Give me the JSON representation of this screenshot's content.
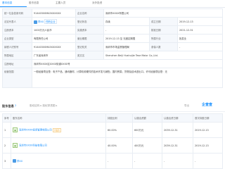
{
  "tabs": [
    "基本信息",
    "股东信息",
    "主要人员",
    "对外投资"
  ],
  "info": {
    "r1": {
      "k1": "统一社会信用代码",
      "v1": "91440300MA5XXXXXX",
      "k2": "企业名称",
      "v2": "深圳市XXXX有限公司"
    },
    "r2": {
      "k1": "法定代表人",
      "v1_name": "李XX",
      "v1_chip": "任职企业",
      "k2": "登记状态",
      "v2": "存续",
      "k3": "成立日期",
      "v3": "2019-12-13"
    },
    "r3": {
      "k1": "注册资本",
      "v1": "1000万元人民币",
      "k2": "实缴资本",
      "v2": "-",
      "k3": "核准日期",
      "v3": "2021-12-31"
    },
    "r4": {
      "k1": "企业类型",
      "v1": "有限责任公司",
      "k2": "营业期限",
      "v2": "2019-12-13 至 无固定期限",
      "k3": "所属行业",
      "v3": "批发业"
    },
    "r5": {
      "k1": "纳税人识别号",
      "v1": "91440300MA5XXXXXX",
      "k2": "登记机关",
      "v2": "深圳市市场监督管理局",
      "k3": "参保人数",
      "v3": "-"
    },
    "r6": {
      "k1": "所属地区",
      "v1": "广东省深圳市",
      "k2": "英文名",
      "v2": "Shenzhen Beiji Hushuijie Tese Maior Co.,Ltd."
    },
    "r7": {
      "k1": "注册地址",
      "v1": "深圳市XXXX区XXXX街道XXXX号"
    },
    "r8": {
      "k1": "经营范围",
      "v1": "一般经营项目是：电子产品、通讯器材、计算机软硬件的技术开发与销售；国内贸易；货物及技术进出口。许可经营项目是：无"
    }
  },
  "section": {
    "title": "股东信息",
    "count": "2",
    "tools": "股权结构 ▸  股权穿透图 ▸",
    "export": "导出",
    "logo": "企查查"
  },
  "shareholders": {
    "headers": [
      "序号",
      "股东名称",
      "持股比例",
      "认缴出资额",
      "认缴出资日期",
      "首次持股日期"
    ],
    "rows": [
      {
        "no": "1",
        "name": "深圳市XXXX投资管理有限公司",
        "tag": "大股东",
        "ratio": "60.00%",
        "amount": "600万元",
        "date": "2039-12-31",
        "first": "2019-12-13"
      },
      {
        "no": "2",
        "name": "深圳市XXXX科技有限公司",
        "tag": "",
        "ratio": "40.00%",
        "amount": "400万元",
        "date": "2039-12-31",
        "first": "2019-12-13"
      },
      {
        "no": "3",
        "name": "李XX",
        "tag": "",
        "ratio": "-",
        "amount": "-",
        "date": "-",
        "first": "-"
      }
    ]
  }
}
